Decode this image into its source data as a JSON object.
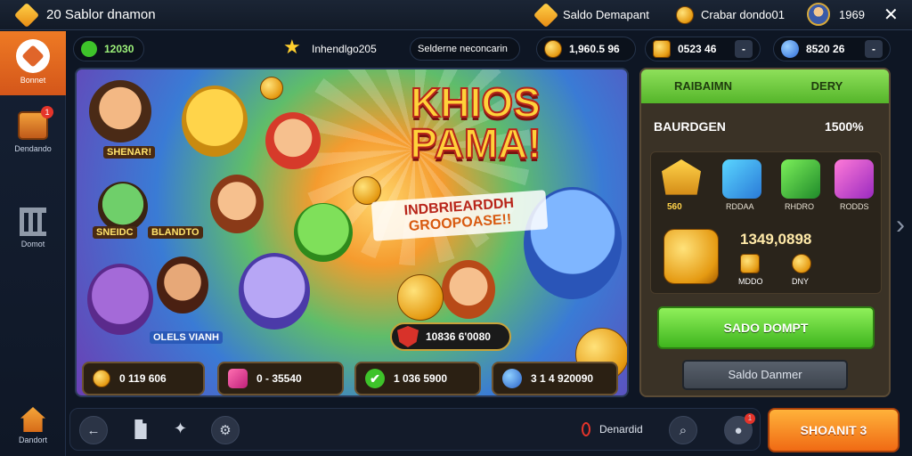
{
  "topbar": {
    "title": "20 Sablor dnamon",
    "saldo_label": "Saldo Demapant",
    "balance_label": "Crabar dondo01",
    "user_value": "1969",
    "close_symbol": "✕"
  },
  "header2": {
    "level_value": "12030",
    "rank_label": "Inhendlgo205",
    "tab_label": "Selderne neconcarin",
    "currency1": "1,960.5 96",
    "currency2": "0523 46",
    "currency3": "8520 26",
    "minus_symbol": "-"
  },
  "sidebar": {
    "items": [
      {
        "label": "Bonnet"
      },
      {
        "label": "Dendando"
      },
      {
        "label": "Domot"
      },
      {
        "label": "Dandort"
      }
    ],
    "badge": "1"
  },
  "banner": {
    "title_line1": "KHIOS",
    "title_line2": "PAMA!",
    "sub_line1": "INDBRIEARDDH",
    "sub_line2": "GROOPOASE!!",
    "char_label1": "SHENAR!",
    "char_label2": "SNEIDC",
    "char_label3": "BLANDTO",
    "char_label4": "OLELS VIANH",
    "prize_value": "10836 6'0080"
  },
  "stats": [
    {
      "value": "0 119 606"
    },
    {
      "value": "0 - 35540"
    },
    {
      "value": "1 036 5900"
    },
    {
      "value": "3 1 4 920090"
    }
  ],
  "panel": {
    "tab_left": "RAIBAIMN",
    "tab_right": "DERY",
    "row_label": "BAURDGEN",
    "row_value": "1500%",
    "items": [
      {
        "label": "560"
      },
      {
        "label": "RDDAA"
      },
      {
        "label": "RHDRO"
      },
      {
        "label": "RODDS"
      }
    ],
    "big_value": "1349,0898",
    "mini1": "MDDO",
    "mini2": "DNY",
    "primary_button": "SADO DOMPT",
    "secondary_button": "Saldo Danmer"
  },
  "bottombar": {
    "status_text": "Denardid",
    "cta_button": "SHOANIT 3",
    "badge": "1"
  },
  "colors": {
    "accent_orange": "#f08a24",
    "green": "#4fc02a",
    "panel_brown": "#3a3226",
    "bg_navy": "#0e1624"
  },
  "icons": [
    "diamond-icon",
    "coin-icon",
    "avatar-icon",
    "close-icon",
    "star-icon",
    "gem-icon",
    "arrow-left-icon",
    "puzzle-icon",
    "gear-icon",
    "search-icon",
    "chevron-right-icon",
    "home-icon",
    "bank-icon",
    "chest-icon"
  ]
}
